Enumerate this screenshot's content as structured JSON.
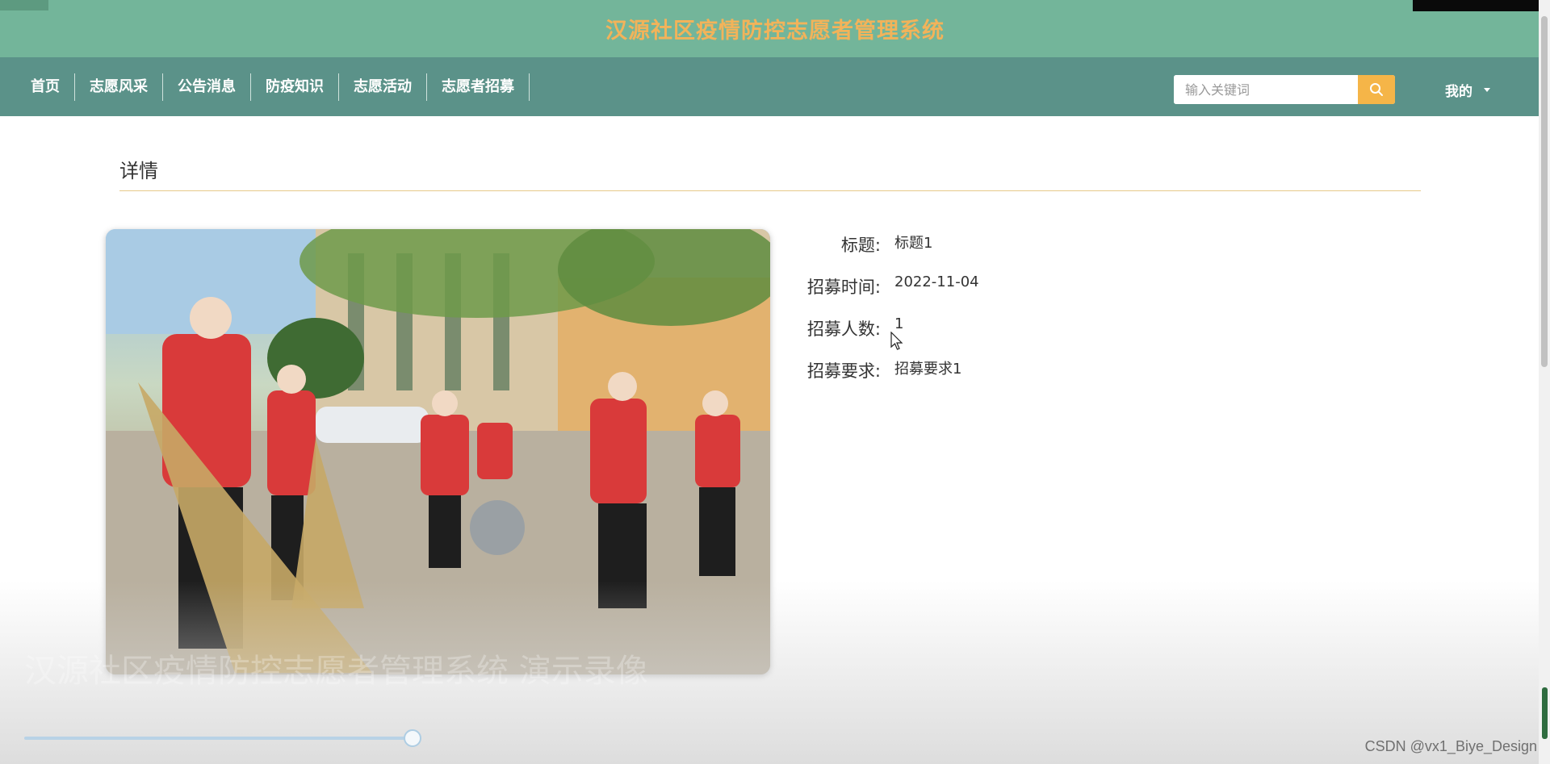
{
  "header": {
    "title": "汉源社区疫情防控志愿者管理系统"
  },
  "nav": {
    "items": [
      {
        "label": "首页"
      },
      {
        "label": "志愿风采"
      },
      {
        "label": "公告消息"
      },
      {
        "label": "防疫知识"
      },
      {
        "label": "志愿活动"
      },
      {
        "label": "志愿者招募"
      }
    ],
    "search_placeholder": "输入关键词",
    "user_menu_label": "我的"
  },
  "section": {
    "title": "详情"
  },
  "details": [
    {
      "label": "标题:",
      "value": "标题1"
    },
    {
      "label": "招募时间:",
      "value": "2022-11-04"
    },
    {
      "label": "招募人数:",
      "value": "1"
    },
    {
      "label": "招募要求:",
      "value": "招募要求1"
    }
  ],
  "overlay": {
    "watermark": "汉源社区疫情防控志愿者管理系统 演示录像",
    "credit": "CSDN @vx1_Biye_Design"
  },
  "colors": {
    "banner": "#73b59a",
    "navbar": "#5b9289",
    "title_text": "#f2b35a",
    "search_button": "#f5b548",
    "divider": "#e6c98a"
  }
}
